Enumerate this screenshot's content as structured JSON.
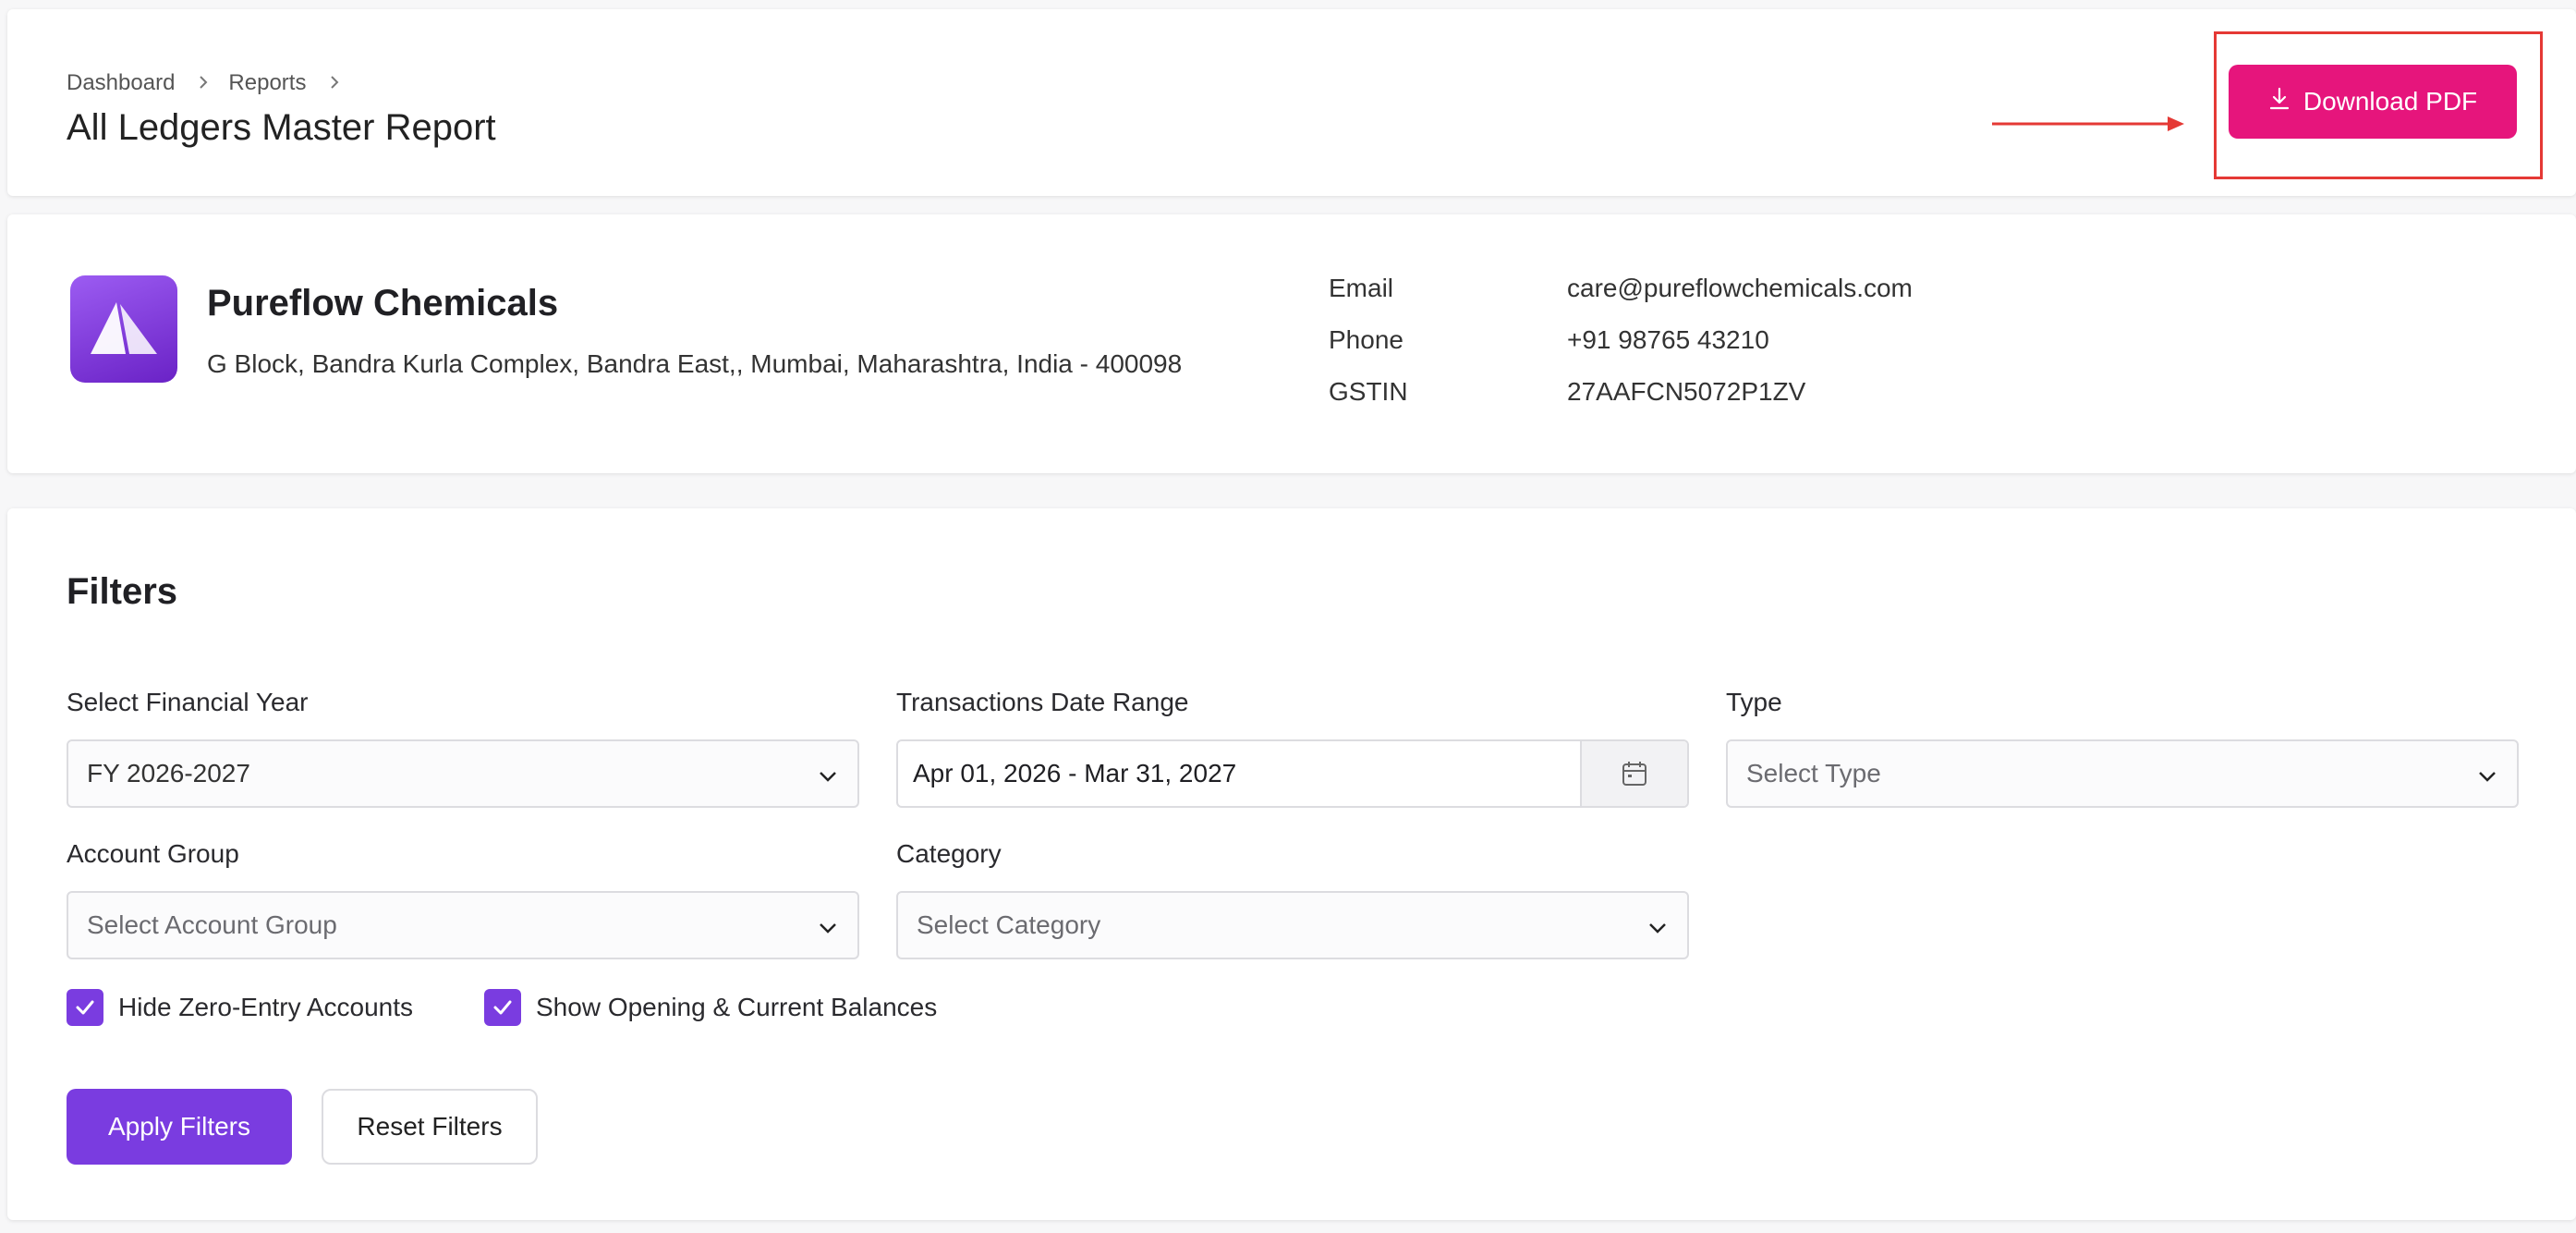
{
  "header": {
    "breadcrumb": [
      "Dashboard",
      "Reports"
    ],
    "title": "All Ledgers Master Report",
    "download_label": "Download PDF"
  },
  "company": {
    "name": "Pureflow Chemicals",
    "address": "G Block, Bandra Kurla Complex, Bandra East,, Mumbai, Maharashtra, India - 400098",
    "email_label": "Email",
    "email": "care@pureflowchemicals.com",
    "phone_label": "Phone",
    "phone": "+91 98765 43210",
    "gstin_label": "GSTIN",
    "gstin": "27AAFCN5072P1ZV"
  },
  "filters": {
    "title": "Filters",
    "financial_year": {
      "label": "Select Financial Year",
      "value": "FY 2026-2027"
    },
    "date_range": {
      "label": "Transactions Date Range",
      "value": "Apr 01, 2026 - Mar 31, 2027"
    },
    "type": {
      "label": "Type",
      "placeholder": "Select Type"
    },
    "account_group": {
      "label": "Account Group",
      "placeholder": "Select Account Group"
    },
    "category": {
      "label": "Category",
      "placeholder": "Select Category"
    },
    "hide_zero": {
      "label": "Hide Zero-Entry Accounts",
      "checked": true
    },
    "show_balances": {
      "label": "Show Opening & Current Balances",
      "checked": true
    },
    "apply_label": "Apply Filters",
    "reset_label": "Reset Filters"
  },
  "colors": {
    "download_button": "#e6157c",
    "primary": "#7a3ce0",
    "annotation": "#e53935"
  }
}
